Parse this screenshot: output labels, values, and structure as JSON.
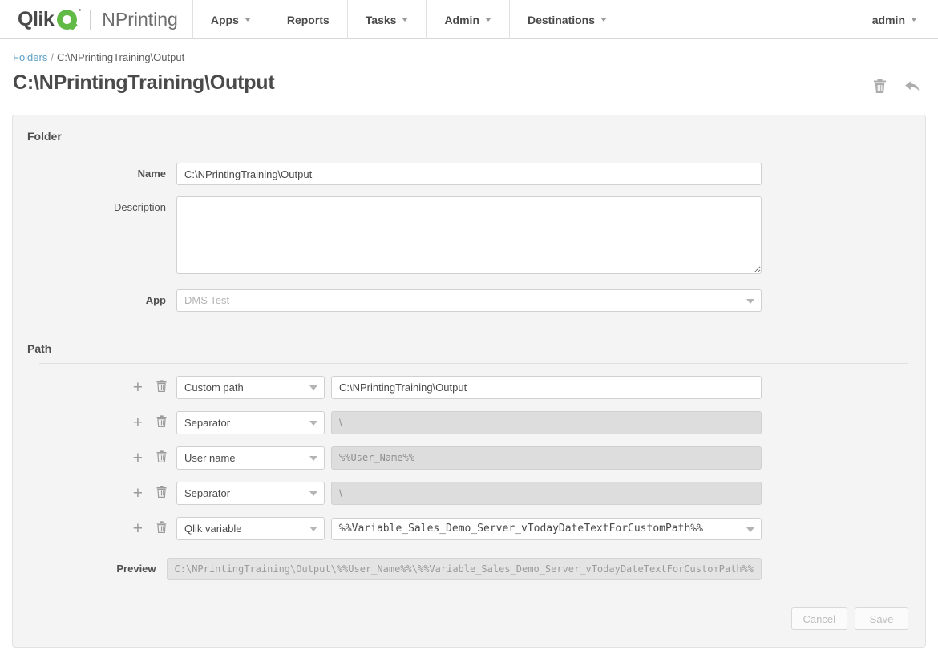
{
  "nav": {
    "brand": {
      "qlik": "Qlik",
      "product": "NPrinting"
    },
    "items": [
      {
        "label": "Apps",
        "has_caret": true
      },
      {
        "label": "Reports",
        "has_caret": false
      },
      {
        "label": "Tasks",
        "has_caret": true
      },
      {
        "label": "Admin",
        "has_caret": true
      },
      {
        "label": "Destinations",
        "has_caret": true
      }
    ],
    "user": {
      "label": "admin",
      "has_caret": true
    }
  },
  "breadcrumb": {
    "root": "Folders",
    "separator": "/",
    "current": "C:\\NPrintingTraining\\Output"
  },
  "page": {
    "title": "C:\\NPrintingTraining\\Output",
    "icons": [
      {
        "name": "delete-icon",
        "label": "Delete"
      },
      {
        "name": "undo-icon",
        "label": "Undo"
      }
    ]
  },
  "folder_section": {
    "title": "Folder",
    "name": {
      "label": "Name",
      "value": "C:\\NPrintingTraining\\Output",
      "placeholder": ""
    },
    "description": {
      "label": "Description",
      "value": "",
      "placeholder": ""
    },
    "app": {
      "label": "App",
      "value": "",
      "placeholder": "DMS Test",
      "disabled": true
    }
  },
  "path_section": {
    "title": "Path",
    "rows": [
      {
        "type": "Custom path",
        "value": "C:\\NPrintingTraining\\Output",
        "value_disabled": false,
        "value_is_select": false,
        "mono": false
      },
      {
        "type": "Separator",
        "value": "\\",
        "value_disabled": true,
        "value_is_select": false,
        "mono": false
      },
      {
        "type": "User name",
        "value": "%%User_Name%%",
        "value_disabled": true,
        "value_is_select": false,
        "mono": true
      },
      {
        "type": "Separator",
        "value": "\\",
        "value_disabled": true,
        "value_is_select": false,
        "mono": false
      },
      {
        "type": "Qlik variable",
        "value": "%%Variable_Sales_Demo_Server_vTodayDateTextForCustomPath%%",
        "value_disabled": false,
        "value_is_select": true,
        "mono": true
      }
    ],
    "preview": {
      "label": "Preview",
      "value": "C:\\NPrintingTraining\\Output\\%%User_Name%%\\%%Variable_Sales_Demo_Server_vTodayDateTextForCustomPath%%"
    }
  },
  "footer": {
    "cancel_label": "Cancel",
    "save_label": "Save"
  },
  "colors": {
    "brand_green": "#61b946",
    "link_blue": "#5c9ec4",
    "text_dark": "#4a4a4a",
    "panel_bg": "#f4f4f4",
    "disabled_bg": "#dddddd"
  }
}
